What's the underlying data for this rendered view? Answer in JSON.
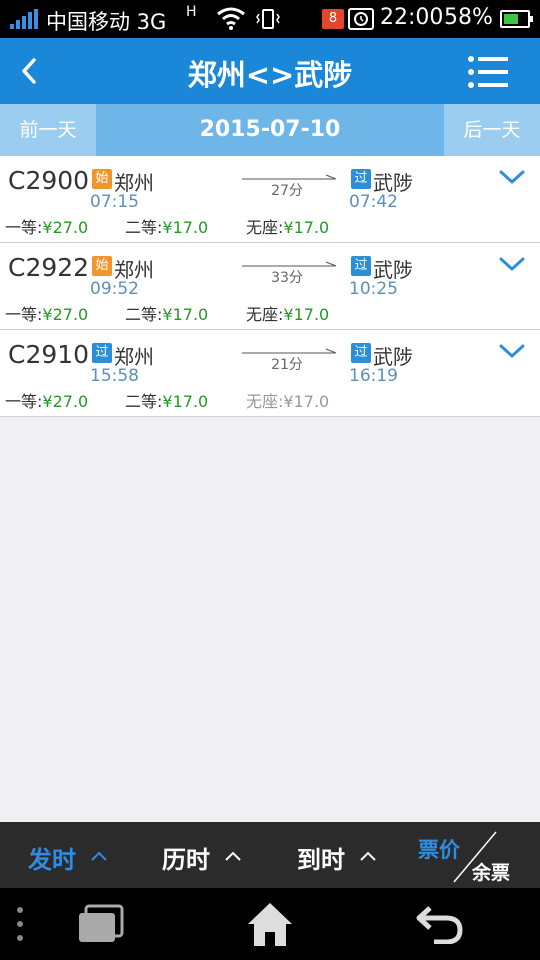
{
  "status_bar": {
    "carrier": "中国移动 3G",
    "network_type": "H",
    "notification_count": "8",
    "time": "22:00",
    "battery": "58%",
    "battery_level": 0.58,
    "icons": [
      "signal-icon",
      "wifi-icon",
      "vibrate-icon",
      "alarm-icon",
      "battery-icon"
    ]
  },
  "header": {
    "title": "郑州<>武陟"
  },
  "date_bar": {
    "prev_label": "前一天",
    "date": "2015-07-10",
    "next_label": "后一天"
  },
  "trains": [
    {
      "number": "C2900",
      "from_tag": "始",
      "from": "郑州",
      "depart": "07:15",
      "duration": "27分",
      "to_tag": "过",
      "to": "武陟",
      "arrive": "07:42",
      "prices": [
        {
          "label": "一等:",
          "value": "¥27.0",
          "available": true
        },
        {
          "label": "二等:",
          "value": "¥17.0",
          "available": true
        },
        {
          "label": "无座:",
          "value": "¥17.0",
          "available": true
        }
      ]
    },
    {
      "number": "C2922",
      "from_tag": "始",
      "from": "郑州",
      "depart": "09:52",
      "duration": "33分",
      "to_tag": "过",
      "to": "武陟",
      "arrive": "10:25",
      "prices": [
        {
          "label": "一等:",
          "value": "¥27.0",
          "available": true
        },
        {
          "label": "二等:",
          "value": "¥17.0",
          "available": true
        },
        {
          "label": "无座:",
          "value": "¥17.0",
          "available": true
        }
      ]
    },
    {
      "number": "C2910",
      "from_tag": "过",
      "from": "郑州",
      "depart": "15:58",
      "duration": "21分",
      "to_tag": "过",
      "to": "武陟",
      "arrive": "16:19",
      "prices": [
        {
          "label": "一等:",
          "value": "¥27.0",
          "available": true
        },
        {
          "label": "二等:",
          "value": "¥17.0",
          "available": true
        },
        {
          "label": "无座:",
          "value": "¥17.0",
          "available": false
        }
      ]
    }
  ],
  "sort_bar": {
    "depart_label": "发时",
    "duration_label": "历时",
    "arrive_label": "到时",
    "price_label": "票价",
    "remain_label": "余票",
    "active": "depart"
  },
  "colors": {
    "accent": "#1a87d8",
    "date_bar": "#6fb6e8",
    "start_tag": "#f0962c",
    "pass_tag": "#2b8fd8",
    "price_available": "#239a23",
    "price_unavailable": "#999999",
    "sort_active": "#2f8ce0"
  }
}
